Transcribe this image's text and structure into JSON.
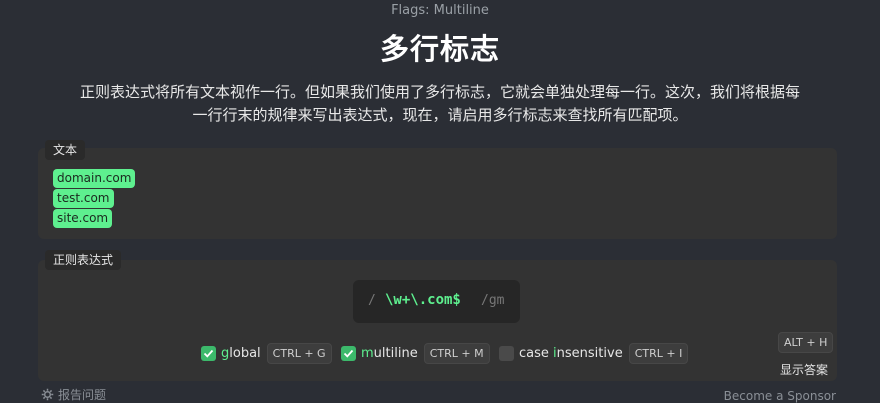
{
  "page_label": "Flags: Multiline",
  "title": "多行标志",
  "description": {
    "line1": "正则表达式将所有文本视作一行。但如果我们使用了多行标志，它就会单独处理每一行。这次，我们将根据每",
    "line2": "一行行末的规律来写出表达式，现在，请启用多行标志来查找所有匹配项。"
  },
  "text_panel": {
    "label": "文本",
    "lines": [
      "domain.com",
      "test.com",
      "site.com"
    ]
  },
  "regex_panel": {
    "label": "正则表达式",
    "slash": "/",
    "value": "\\w+\\.com$",
    "flags_suffix": "/gm"
  },
  "flags": [
    {
      "prefix": "",
      "highlight": "g",
      "rest": "lobal",
      "shortcut": "CTRL + G",
      "checked": true
    },
    {
      "prefix": "",
      "highlight": "m",
      "rest": "ultiline",
      "shortcut": "CTRL + M",
      "checked": true
    },
    {
      "prefix": "case ",
      "highlight": "i",
      "rest": "nsensitive",
      "shortcut": "CTRL + I",
      "checked": false
    }
  ],
  "answer": {
    "shortcut": "ALT + H",
    "label": "显示答案"
  },
  "footer": {
    "report": "报告问题",
    "report_icon": "gear-icon",
    "sponsor": "Become a Sponsor"
  },
  "colors": {
    "background": "#2b2e35",
    "panel": "#333333",
    "accent": "#5ef08f",
    "checkbox": "#3cb96b"
  }
}
